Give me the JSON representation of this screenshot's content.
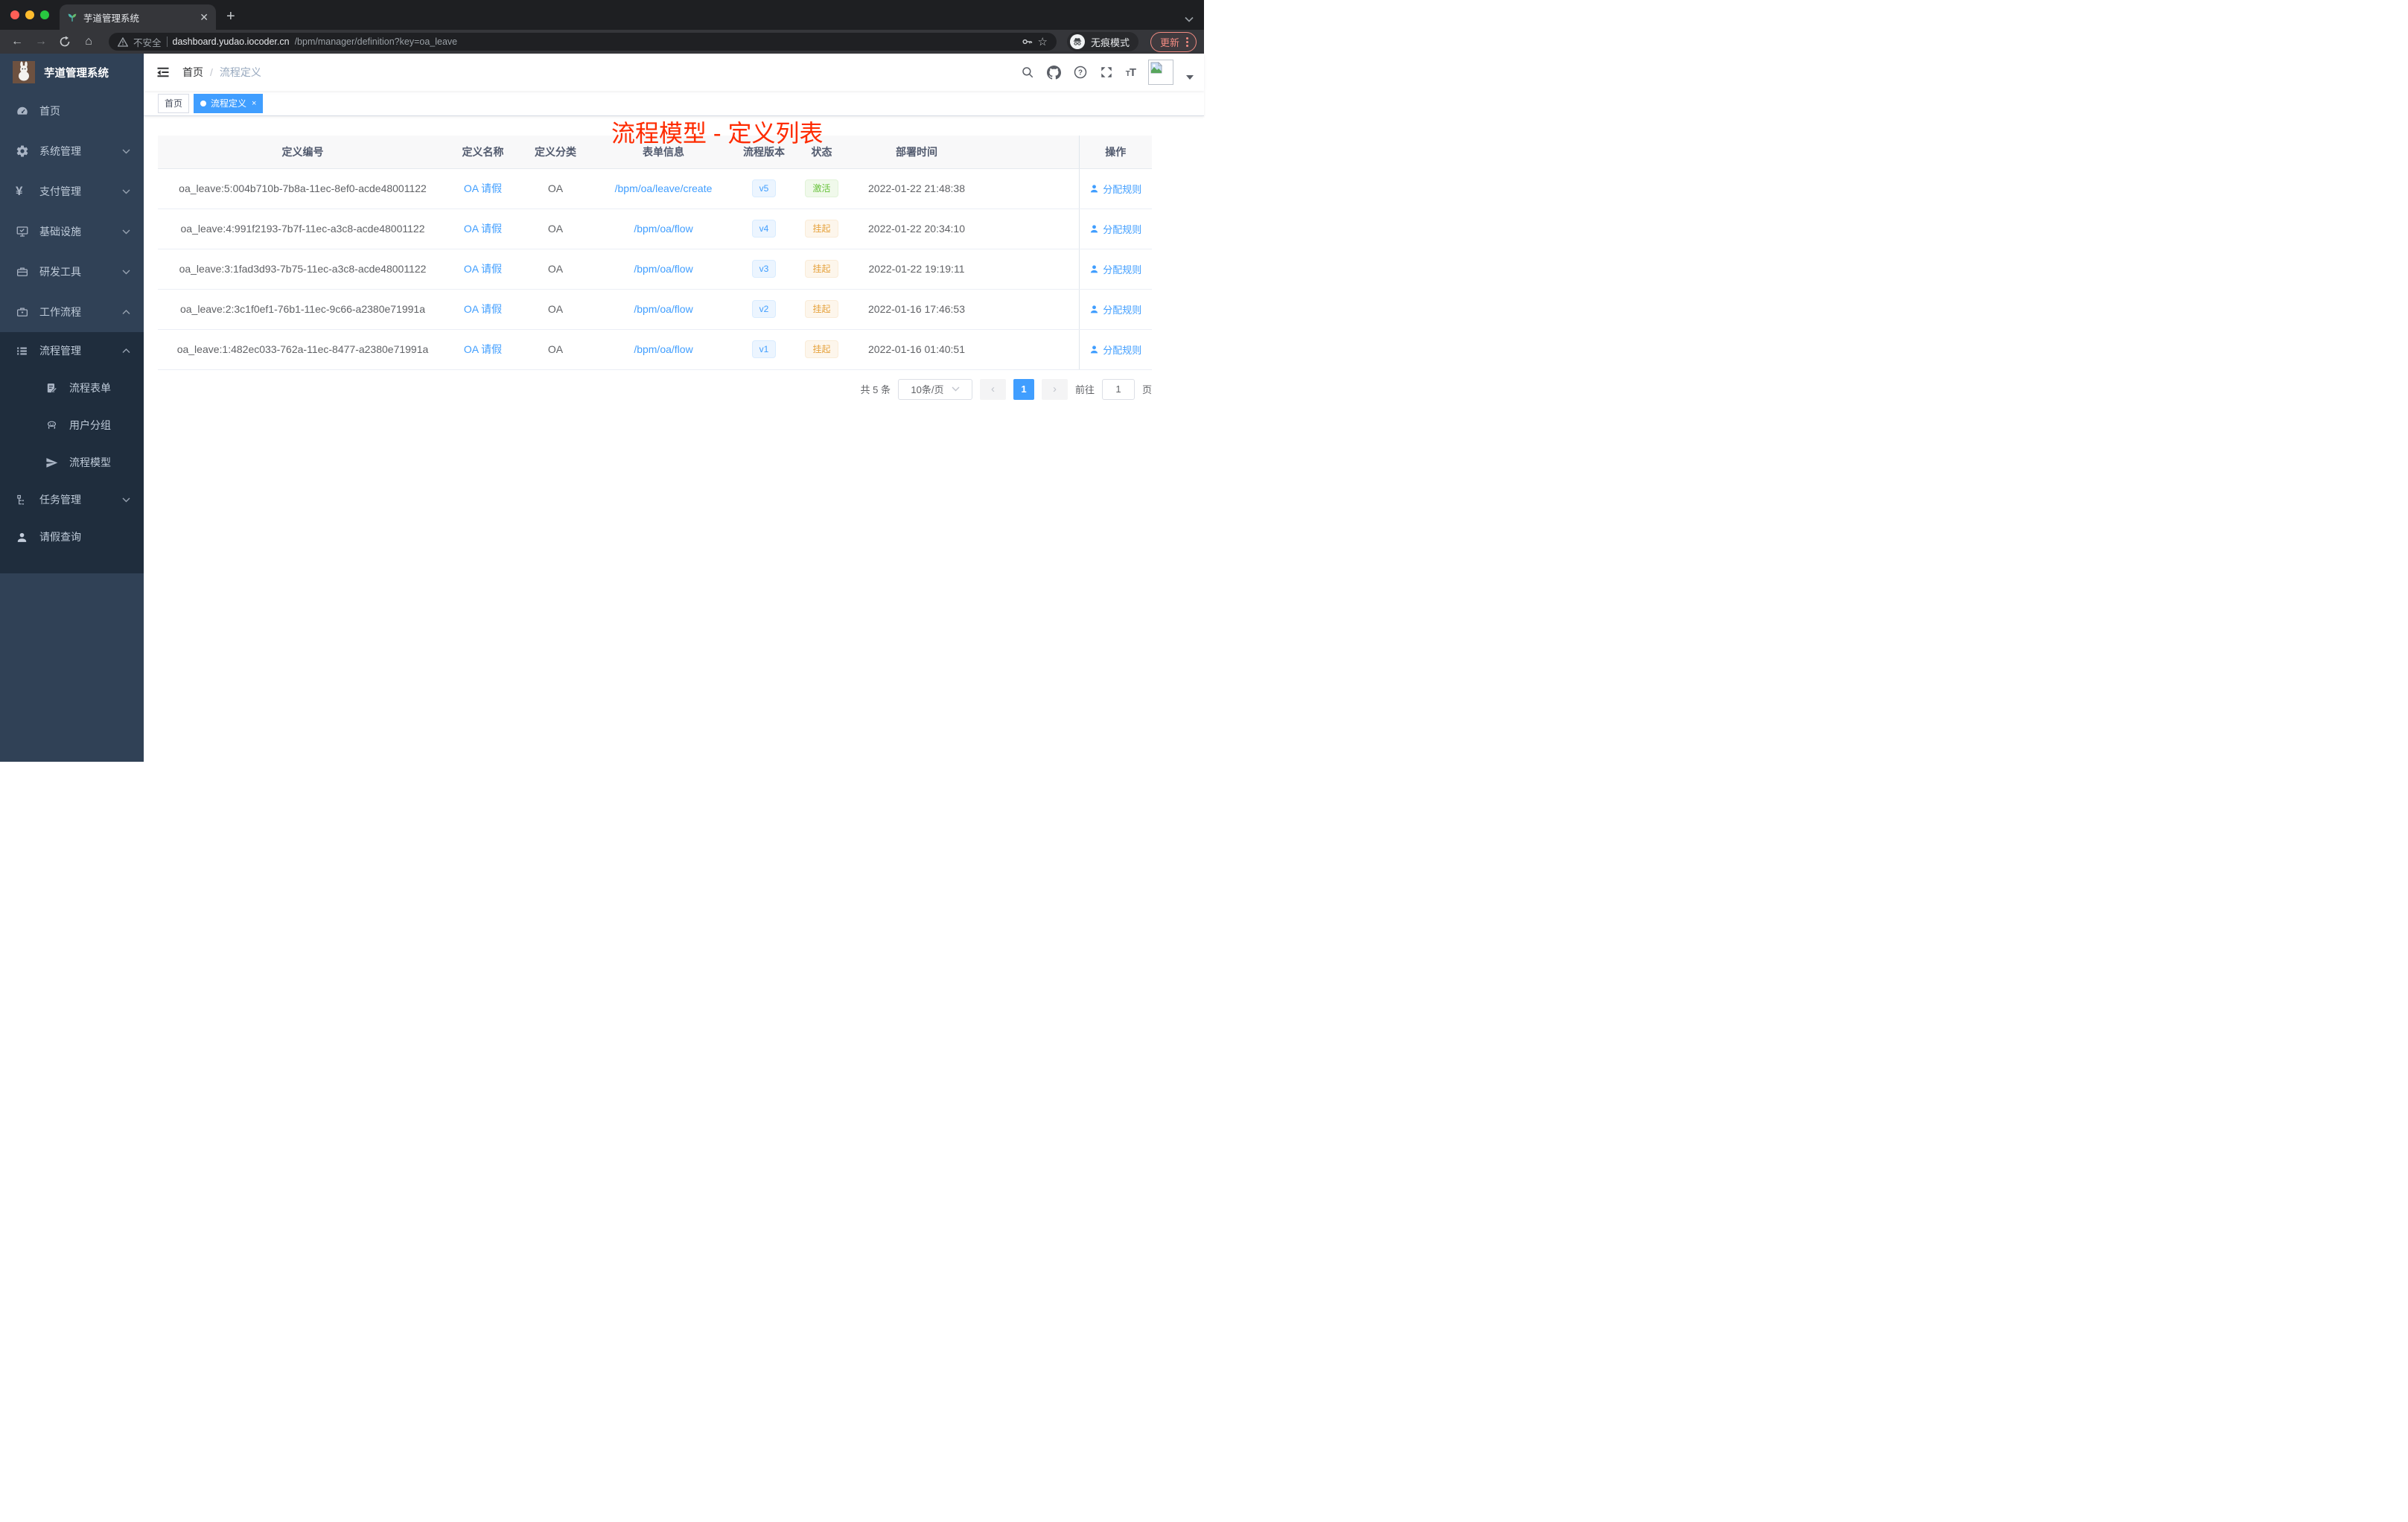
{
  "colors": {
    "accent": "#409eff",
    "success": "#67c23a",
    "warning": "#e6a23c",
    "annotation_red": "#fe2b00",
    "sidebar_bg": "#304156",
    "submenu_bg": "#1f2d3d",
    "active_tag_bg": "#409eff"
  },
  "browser": {
    "tab_title": "芋道管理系统",
    "tab_favicon": "plant-icon",
    "new_tab": "+",
    "close_tab": "✕",
    "security_label": "不安全",
    "url_host": "dashboard.yudao.iocoder.cn",
    "url_path": "/bpm/manager/definition?key=oa_leave",
    "incognito_label": "无痕模式",
    "update_label": "更新"
  },
  "sidebar": {
    "logo_title": "芋道管理系统",
    "items": [
      {
        "label": "首页",
        "icon": "dashboard-icon"
      },
      {
        "label": "系统管理",
        "icon": "gear-icon"
      },
      {
        "label": "支付管理",
        "icon": "yen-icon"
      },
      {
        "label": "基础设施",
        "icon": "monitor-icon"
      },
      {
        "label": "研发工具",
        "icon": "toolbox-icon"
      },
      {
        "label": "工作流程",
        "icon": "briefcase-icon"
      }
    ],
    "submenu": {
      "process_mgmt": {
        "label": "流程管理",
        "icon": "list-icon"
      },
      "children": [
        {
          "label": "流程表单",
          "icon": "form-icon"
        },
        {
          "label": "用户分组",
          "icon": "robot-icon"
        },
        {
          "label": "流程模型",
          "icon": "send-icon"
        }
      ],
      "task_mgmt": {
        "label": "任务管理",
        "icon": "tree-icon"
      },
      "leave_query": {
        "label": "请假查询",
        "icon": "user-icon"
      }
    }
  },
  "header": {
    "breadcrumb": {
      "home": "首页",
      "separator": "/",
      "current": "流程定义"
    },
    "annotation": "流程模型 - 定义列表",
    "icons": [
      "search-icon",
      "github-icon",
      "help-icon",
      "fullscreen-icon",
      "font-size-icon",
      "avatar",
      "caret-down-icon"
    ]
  },
  "tags": {
    "home": {
      "label": "首页"
    },
    "active": {
      "label": "流程定义",
      "close": "×"
    }
  },
  "table": {
    "columns": {
      "id": "定义编号",
      "name": "定义名称",
      "category": "定义分类",
      "form": "表单信息",
      "version": "流程版本",
      "status": "状态",
      "time": "部署时间",
      "op": "操作"
    },
    "rows": [
      {
        "id": "oa_leave:5:004b710b-7b8a-11ec-8ef0-acde48001122",
        "name": "OA 请假",
        "category": "OA",
        "form": "/bpm/oa/leave/create",
        "version": "v5",
        "status": "激活",
        "time": "2022-01-22 21:48:38",
        "action": "分配规则"
      },
      {
        "id": "oa_leave:4:991f2193-7b7f-11ec-a3c8-acde48001122",
        "name": "OA 请假",
        "category": "OA",
        "form": "/bpm/oa/flow",
        "version": "v4",
        "status": "挂起",
        "time": "2022-01-22 20:34:10",
        "action": "分配规则"
      },
      {
        "id": "oa_leave:3:1fad3d93-7b75-11ec-a3c8-acde48001122",
        "name": "OA 请假",
        "category": "OA",
        "form": "/bpm/oa/flow",
        "version": "v3",
        "status": "挂起",
        "time": "2022-01-22 19:19:11",
        "action": "分配规则"
      },
      {
        "id": "oa_leave:2:3c1f0ef1-76b1-11ec-9c66-a2380e71991a",
        "name": "OA 请假",
        "category": "OA",
        "form": "/bpm/oa/flow",
        "version": "v2",
        "status": "挂起",
        "time": "2022-01-16 17:46:53",
        "action": "分配规则"
      },
      {
        "id": "oa_leave:1:482ec033-762a-11ec-8477-a2380e71991a",
        "name": "OA 请假",
        "category": "OA",
        "form": "/bpm/oa/flow",
        "version": "v1",
        "status": "挂起",
        "time": "2022-01-16 01:40:51",
        "action": "分配规则"
      }
    ]
  },
  "pagination": {
    "total": "共 5 条",
    "page_size": "10条/页",
    "prev": "‹",
    "current_page": "1",
    "next": "›",
    "goto_label": "前往",
    "goto_value": "1",
    "goto_suffix": "页"
  }
}
